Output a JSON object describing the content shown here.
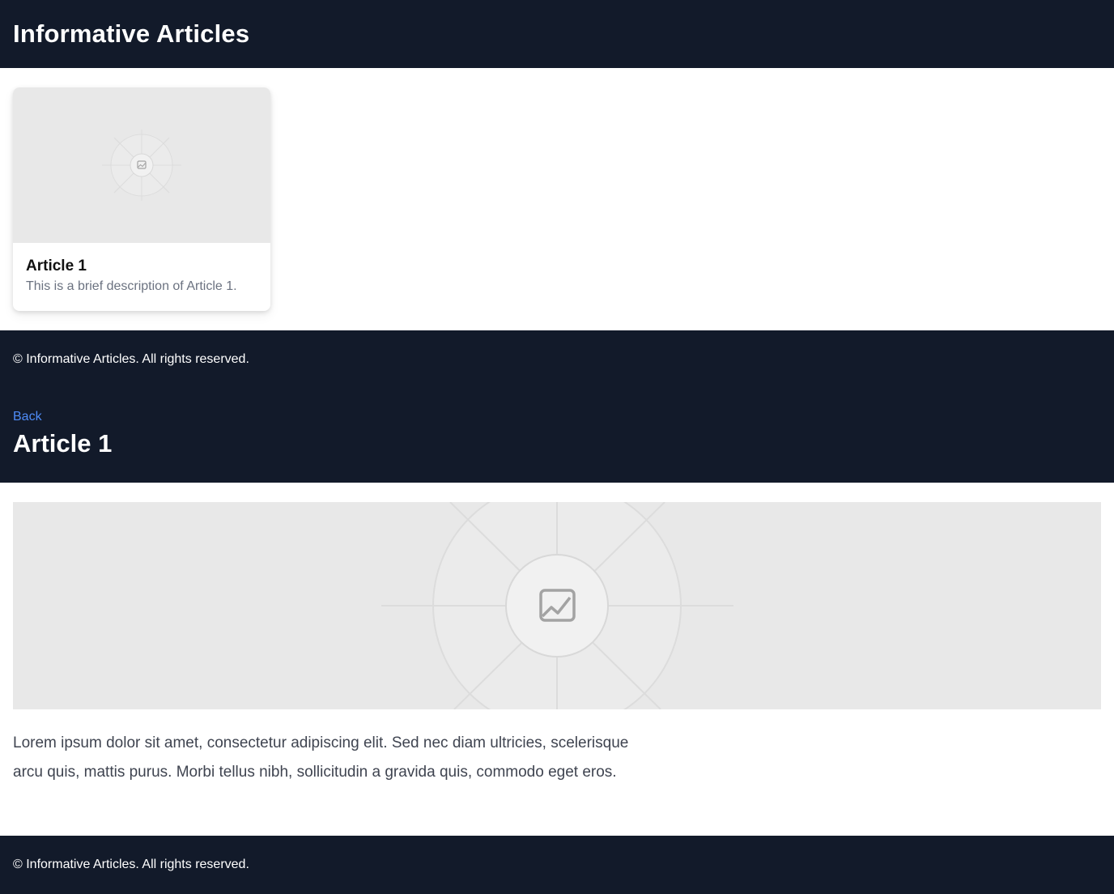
{
  "site": {
    "title": "Informative Articles"
  },
  "articles": [
    {
      "title": "Article 1",
      "description": "This is a brief description of Article 1."
    }
  ],
  "footer": {
    "text": "© Informative Articles. All rights reserved."
  },
  "detail": {
    "back_label": "Back",
    "title": "Article 1",
    "body": "Lorem ipsum dolor sit amet, consectetur adipiscing elit. Sed nec diam ultricies, scelerisque arcu quis, mattis purus. Morbi tellus nibh, sollicitudin a gravida quis, commodo eget eros."
  },
  "colors": {
    "dark_bg": "#121a2a",
    "link": "#4f8cf7",
    "placeholder_bg": "#e8e8e8"
  },
  "icons": {
    "card_image": "image-placeholder-icon",
    "hero_image": "image-placeholder-icon"
  }
}
